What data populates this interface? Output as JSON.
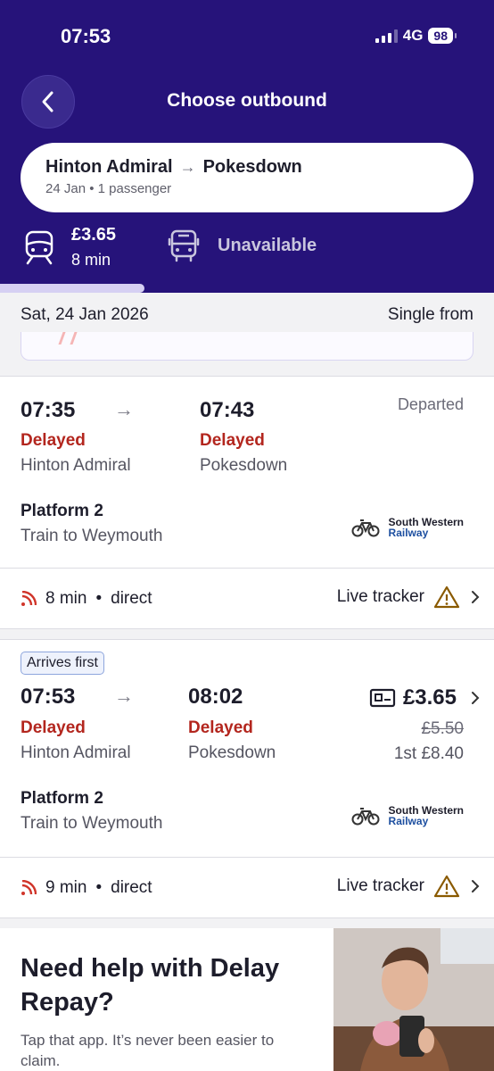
{
  "status_bar": {
    "time": "07:53",
    "network": "4G",
    "battery": "98"
  },
  "header": {
    "title": "Choose outbound",
    "back_icon": "chevron-left-icon"
  },
  "journey": {
    "from": "Hinton Admiral",
    "to": "Pokesdown",
    "details": "24 Jan • 1 passenger"
  },
  "modes": {
    "train": {
      "price": "£3.65",
      "duration": "8 min",
      "icon": "train-icon"
    },
    "bus": {
      "label": "Unavailable",
      "icon": "bus-icon"
    }
  },
  "date_bar": {
    "date": "Sat, 24 Jan 2026",
    "fare_label": "Single from"
  },
  "services": [
    {
      "depart_time": "07:35",
      "depart_status": "Delayed",
      "depart_station": "Hinton Admiral",
      "arrive_time": "07:43",
      "arrive_status": "Delayed",
      "arrive_station": "Pokesdown",
      "state": "Departed",
      "platform": "Platform 2",
      "destination": "Train to Weymouth",
      "operator_line1": "South Western",
      "operator_line2": "Railway",
      "duration": "8 min",
      "route_type": "direct",
      "tracker_label": "Live tracker"
    },
    {
      "badge": "Arrives first",
      "depart_time": "07:53",
      "depart_status": "Delayed",
      "depart_station": "Hinton Admiral",
      "arrive_time": "08:02",
      "arrive_status": "Delayed",
      "arrive_station": "Pokesdown",
      "price": "£3.65",
      "old_price": "£5.50",
      "first_class": "1st £8.40",
      "platform": "Platform 2",
      "destination": "Train to Weymouth",
      "operator_line1": "South Western",
      "operator_line2": "Railway",
      "duration": "9 min",
      "route_type": "direct",
      "tracker_label": "Live tracker"
    }
  ],
  "separator": "•",
  "help": {
    "title": "Need help with Delay Repay?",
    "text": "Tap that app. It’s never been easier to claim."
  },
  "colors": {
    "header": "#26137a",
    "delayed": "#b3261e",
    "warning": "#8a5a00",
    "live": "#d0352a"
  }
}
